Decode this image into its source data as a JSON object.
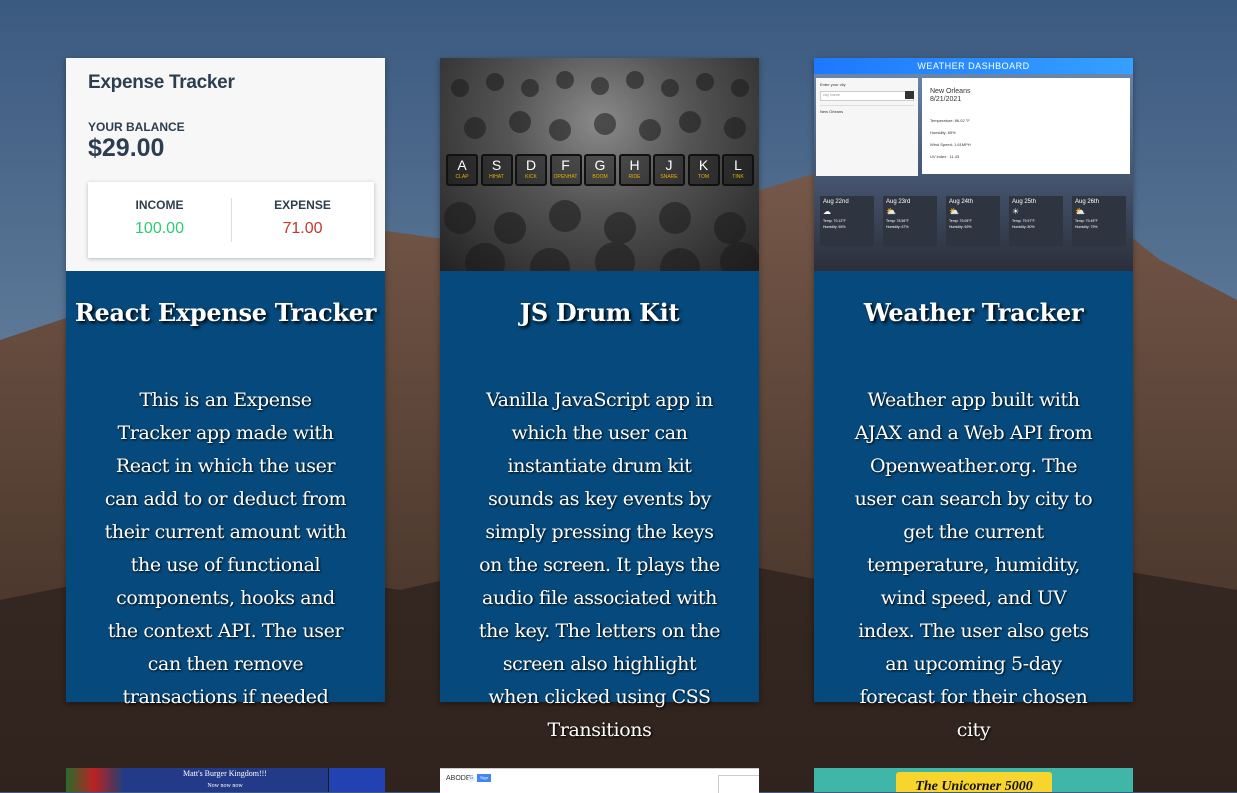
{
  "projects": [
    {
      "title": "React Expense Tracker",
      "description": "This is an Expense Tracker app made with React in which the user can add to or deduct from their current amount with the use of functional components, hooks and the context API. The user can then remove transactions if needed",
      "thumb": {
        "heading": "Expense Tracker",
        "balance_label": "YOUR BALANCE",
        "balance": "$29.00",
        "income_label": "INCOME",
        "income": "100.00",
        "expense_label": "EXPENSE",
        "expense": "71.00",
        "income_color": "#2ecc71",
        "expense_color": "#c0392b"
      }
    },
    {
      "title": "JS Drum Kit",
      "description": "Vanilla JavaScript app in which the user can instantiate drum kit sounds as key events by simply pressing the keys on the screen. It plays the audio file associated with the key. The letters on the screen also highlight when clicked using CSS Transitions",
      "thumb": {
        "keys": [
          {
            "k": "A",
            "s": "clap"
          },
          {
            "k": "S",
            "s": "hihat"
          },
          {
            "k": "D",
            "s": "kick"
          },
          {
            "k": "F",
            "s": "openhat"
          },
          {
            "k": "G",
            "s": "boom"
          },
          {
            "k": "H",
            "s": "ride"
          },
          {
            "k": "J",
            "s": "snare"
          },
          {
            "k": "K",
            "s": "tom"
          },
          {
            "k": "L",
            "s": "tink"
          }
        ]
      }
    },
    {
      "title": "Weather Tracker",
      "description": "Weather app built with AJAX and a Web API from Openweather.org. The user can search by city to get the current temperature, humidity, wind speed, and UV index. The user also gets an upcoming 5-day forecast for their chosen city",
      "thumb": {
        "header": "WEATHER DASHBOARD",
        "enter_city_label": "Enter your city",
        "city_placeholder": "city name",
        "saved_city": "New Orleans",
        "city": "New Orleans",
        "date": "8/21/2021",
        "temperature": "Temperature: 86.02 °F",
        "humidity": "Humidity: 65%",
        "wind": "Wind Speed: 1.61MPH",
        "uv": "UV index : 11.43",
        "days": [
          {
            "d": "Aug 22nd",
            "i": "☁",
            "t": "Temp: 79.12°F",
            "h": "Humidity: 65%"
          },
          {
            "d": "Aug 23rd",
            "i": "⛅",
            "t": "Temp: 78.56°F",
            "h": "Humidity: 67%"
          },
          {
            "d": "Aug 24th",
            "i": "⛅",
            "t": "Temp: 79.05°F",
            "h": "Humidity: 69%"
          },
          {
            "d": "Aug 25th",
            "i": "☀",
            "t": "Temp: 79.97°F",
            "h": "Humidity: 80%"
          },
          {
            "d": "Aug 26th",
            "i": "⛅",
            "t": "Temp: 79.45°F",
            "h": "Humidity: 79%"
          }
        ]
      }
    }
  ],
  "bottom_row": [
    {
      "caption": "Matt's Burger Kingdom!!!",
      "sub": "Now now now"
    },
    {
      "logo": "ABODE",
      "google": "G",
      "signin": "Sign out"
    },
    {
      "banner": "The Unicorner 5000"
    }
  ]
}
